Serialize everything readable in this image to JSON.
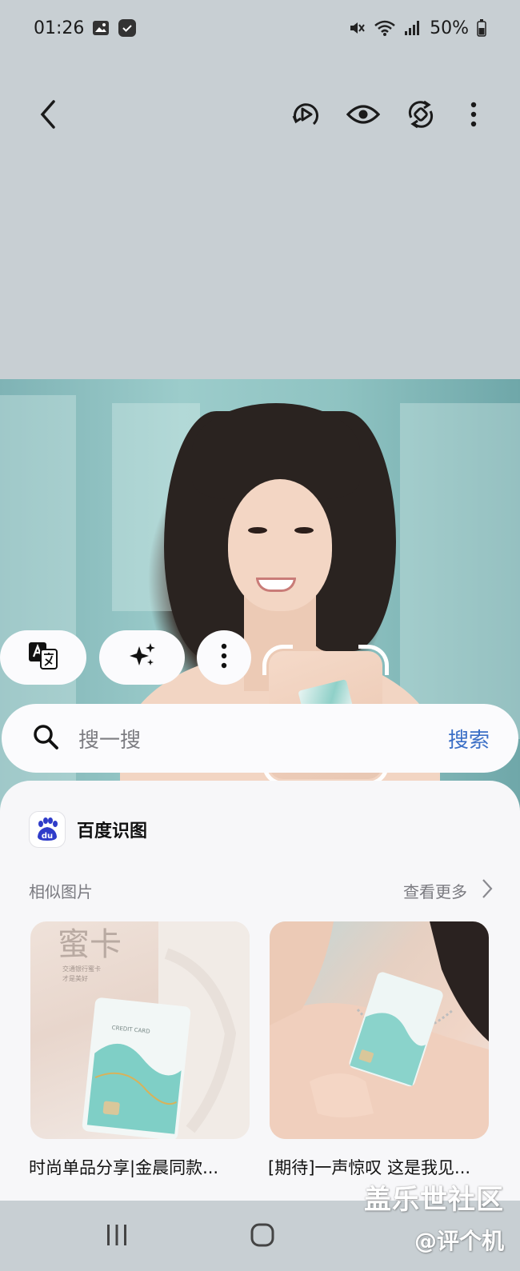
{
  "status_bar": {
    "time": "01:26",
    "battery": "50%",
    "icons": [
      "gallery-icon",
      "task-check-icon",
      "mute-icon",
      "wifi-icon",
      "signal-icon",
      "battery-icon"
    ]
  },
  "toolbar": {
    "icons": [
      "back-arrow-icon",
      "motion-play-icon",
      "eye-icon",
      "rotate-icon",
      "more-vert-icon"
    ]
  },
  "actions": {
    "icons": [
      "translate-icon",
      "sparkle-icon",
      "more-vert-icon"
    ]
  },
  "search": {
    "placeholder": "搜一搜",
    "action_label": "搜索"
  },
  "results": {
    "provider": "百度识图",
    "section_title": "相似图片",
    "more_label": "查看更多",
    "items": [
      {
        "caption": "时尚单品分享|金晨同款..."
      },
      {
        "caption": "[期待]一声惊叹 这是我见..."
      }
    ]
  },
  "thumb_text": {
    "title": "蜜卡",
    "lines": [
      "交通银行蜜卡",
      "才是美好"
    ],
    "card_text": "CREDIT CARD"
  },
  "watermark": {
    "line1": "盖乐世社区",
    "line2": "@评个机"
  },
  "colors": {
    "accent": "#3b6fc6",
    "sheet_bg": "#f7f7f9",
    "chrome_bg": "#c8cfd3"
  }
}
